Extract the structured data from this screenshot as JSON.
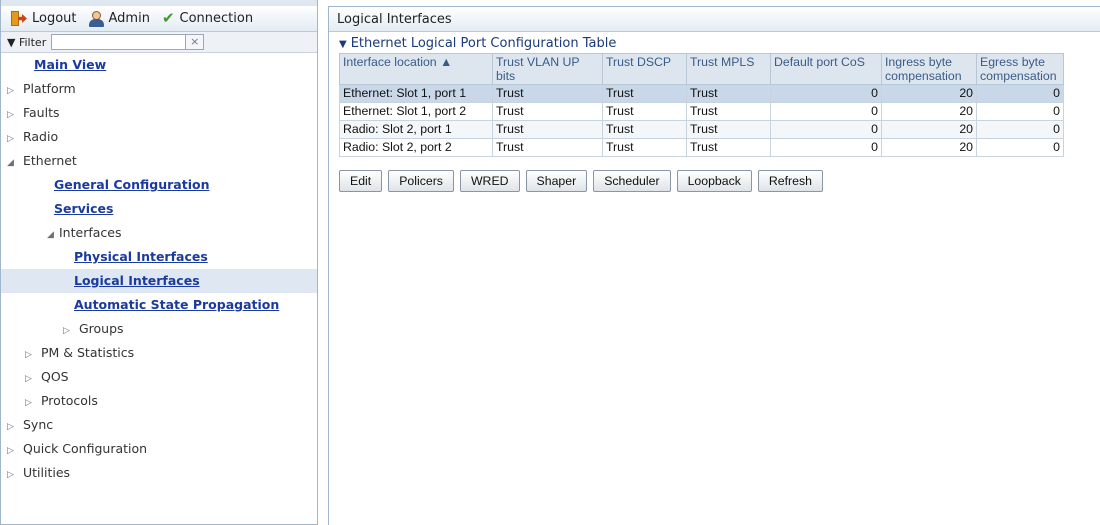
{
  "toolbar": {
    "logout_label": "Logout",
    "admin_label": "Admin",
    "connection_label": "Connection"
  },
  "filter": {
    "label": "Filter",
    "value": "",
    "clear_icon": "×"
  },
  "nav": {
    "main_view": "Main View",
    "platform": "Platform",
    "faults": "Faults",
    "radio": "Radio",
    "ethernet": "Ethernet",
    "general_configuration": "General Configuration",
    "services": "Services",
    "interfaces": "Interfaces",
    "physical_interfaces": "Physical Interfaces",
    "logical_interfaces": "Logical Interfaces",
    "automatic_state_propagation": "Automatic State Propagation",
    "groups": "Groups",
    "pm_statistics": "PM & Statistics",
    "qos": "QOS",
    "protocols": "Protocols",
    "sync": "Sync",
    "quick_configuration": "Quick Configuration",
    "utilities": "Utilities",
    "collapsed_caret": "▷",
    "expanded_caret": "◢",
    "selected_item": "Logical Interfaces"
  },
  "page": {
    "title": "Logical Interfaces",
    "section_caret": "▼",
    "section_title": "Ethernet Logical Port Configuration Table"
  },
  "table": {
    "headers": [
      "Interface location ▲",
      "Trust VLAN UP bits",
      "Trust DSCP",
      "Trust MPLS",
      "Default port CoS",
      "Ingress byte compensation",
      "Egress byte compensation"
    ],
    "rows": [
      [
        "Ethernet: Slot 1, port 1",
        "Trust",
        "Trust",
        "Trust",
        "0",
        "20",
        "0"
      ],
      [
        "Ethernet: Slot 1, port 2",
        "Trust",
        "Trust",
        "Trust",
        "0",
        "20",
        "0"
      ],
      [
        "Radio: Slot 2, port 1",
        "Trust",
        "Trust",
        "Trust",
        "0",
        "20",
        "0"
      ],
      [
        "Radio: Slot 2, port 2",
        "Trust",
        "Trust",
        "Trust",
        "0",
        "20",
        "0"
      ]
    ],
    "selected_row": 0
  },
  "buttons": {
    "edit": "Edit",
    "policers": "Policers",
    "wred": "WRED",
    "shaper": "Shaper",
    "scheduler": "Scheduler",
    "loopback": "Loopback",
    "refresh": "Refresh"
  },
  "colors": {
    "link": "#1a3aa0",
    "selected_row": "#c8d8e8",
    "header_bg": "#dde6ef",
    "header_text": "#3a5b86"
  }
}
